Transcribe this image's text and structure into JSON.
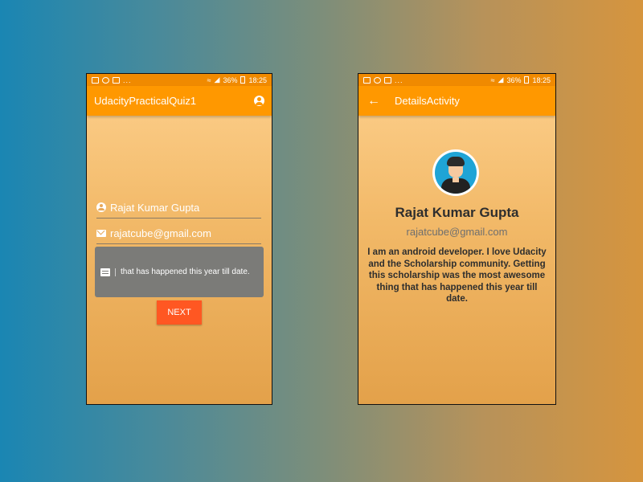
{
  "status_bar": {
    "notif_dots": "...",
    "battery": "36%",
    "time": "18:25"
  },
  "quiz_screen": {
    "title": "UdacityPracticalQuiz1",
    "name_value": "Rajat Kumar Gupta",
    "email_value": "rajatcube@gmail.com",
    "comment_value": "that has happened this year till date.",
    "next_label": "NEXT"
  },
  "details_screen": {
    "title": "DetailsActivity",
    "name": "Rajat Kumar Gupta",
    "email": "rajatcube@gmail.com",
    "bio": "I am an android developer. I love Udacity and the Scholarship community. Getting this scholarship was the most awesome thing that has happened this year till date."
  },
  "colors": {
    "app_bar": "#ff9800",
    "status_bar": "#f08a00",
    "button": "#ff5722"
  }
}
